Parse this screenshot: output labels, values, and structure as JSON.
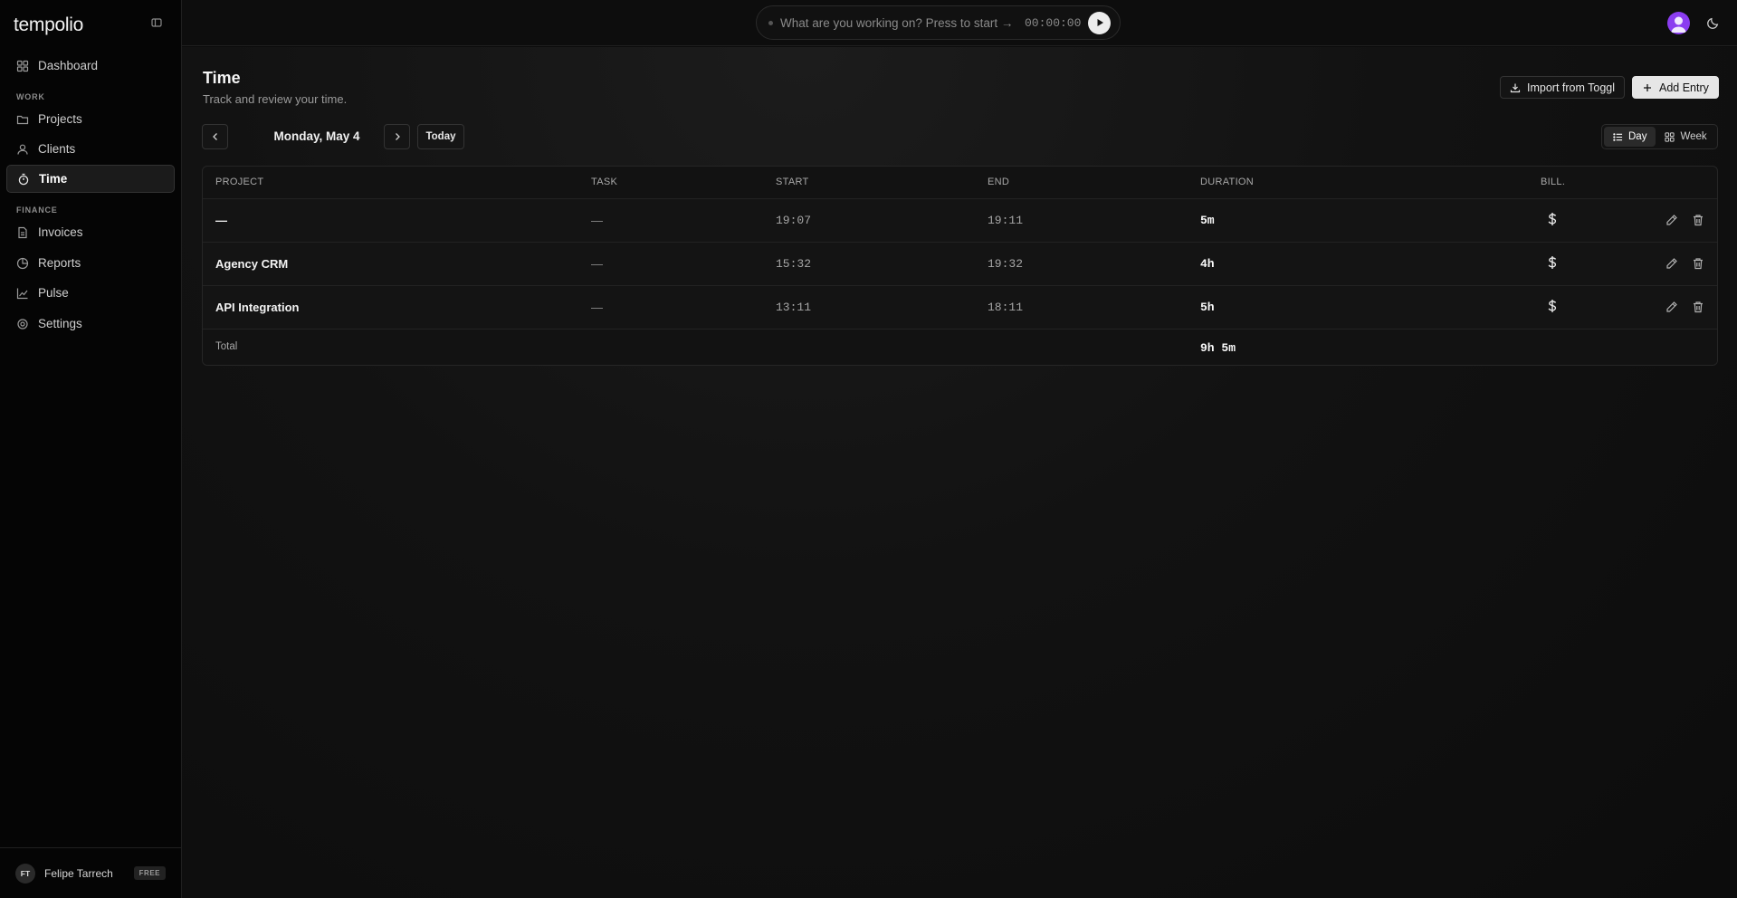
{
  "app": {
    "brand": "tempolio",
    "accent_color": "#8b3df0"
  },
  "sidebar": {
    "items_top": [
      {
        "label": "Dashboard",
        "icon": "grid-icon"
      }
    ],
    "sections": [
      {
        "title": "WORK",
        "items": [
          {
            "label": "Projects",
            "icon": "folder-icon"
          },
          {
            "label": "Clients",
            "icon": "user-icon"
          },
          {
            "label": "Time",
            "icon": "stopwatch-icon",
            "active": true
          }
        ]
      },
      {
        "title": "FINANCE",
        "items": [
          {
            "label": "Invoices",
            "icon": "document-icon"
          },
          {
            "label": "Reports",
            "icon": "pie-chart-icon"
          },
          {
            "label": "Pulse",
            "icon": "line-chart-icon"
          },
          {
            "label": "Settings",
            "icon": "gear-icon"
          }
        ]
      }
    ],
    "user": {
      "initials": "FT",
      "name": "Felipe Tarrech",
      "plan": "FREE"
    }
  },
  "topbar": {
    "timer_placeholder": "What are you working on? Press to start →",
    "timer_value": "00:00:00"
  },
  "page": {
    "title": "Time",
    "subtitle": "Track and review your time.",
    "import_label": "Import from Toggl",
    "add_label": "Add Entry",
    "date": "Monday, May 4",
    "today_label": "Today",
    "views": [
      {
        "label": "Day",
        "active": true
      },
      {
        "label": "Week",
        "active": false
      }
    ]
  },
  "table": {
    "headers": [
      "PROJECT",
      "TASK",
      "START",
      "END",
      "DURATION",
      "BILL."
    ],
    "rows": [
      {
        "project": "—",
        "task": "—",
        "start": "19:07",
        "end": "19:11",
        "duration": "5m",
        "billable": true
      },
      {
        "project": "Agency CRM",
        "task": "—",
        "start": "15:32",
        "end": "19:32",
        "duration": "4h",
        "billable": true
      },
      {
        "project": "API Integration",
        "task": "—",
        "start": "13:11",
        "end": "18:11",
        "duration": "5h",
        "billable": true
      }
    ],
    "total_label": "Total",
    "total_value": "9h 5m"
  }
}
